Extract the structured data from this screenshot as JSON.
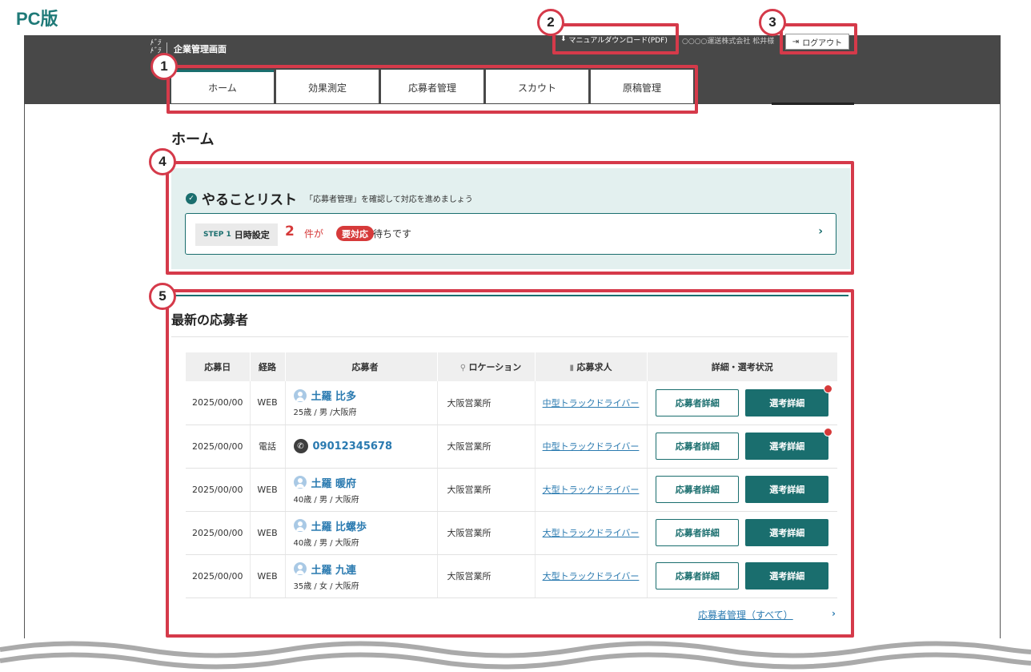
{
  "pc_label": "PC版",
  "header": {
    "logo_text": "ドラ\nドラ",
    "app_title": "企業管理画面",
    "manual_download": "マニュアルダウンロード(PDF)",
    "company": "○○○○運送株式会社 松井様",
    "logout": "ログアウト"
  },
  "tabs": [
    {
      "label": "ホーム",
      "active": true
    },
    {
      "label": "効果測定"
    },
    {
      "label": "応募者管理"
    },
    {
      "label": "スカウト"
    },
    {
      "label": "原稿管理"
    }
  ],
  "page_title": "ホーム",
  "todo": {
    "title": "やることリスト",
    "subtitle": "「応募者管理」を確認して対応を進めましょう",
    "step_label": "STEP 1",
    "step_name": "日時設定",
    "count": "2",
    "text_before": "件が",
    "pill": "要対応",
    "text_after": "待ちです"
  },
  "applicants": {
    "title": "最新の応募者",
    "columns": {
      "date": "応募日",
      "route": "経路",
      "applicant": "応募者",
      "location": "ロケーション",
      "job": "応募求人",
      "actions": "詳細・選考状況"
    },
    "detail_label": "応募者詳細",
    "select_label": "選考詳細",
    "rows": [
      {
        "date": "2025/00/00",
        "route": "WEB",
        "name": "土羅 比多",
        "meta": "25歳 / 男 /大阪府",
        "location": "大阪営業所",
        "job": "中型トラックドライバー",
        "notify": true
      },
      {
        "date": "2025/00/00",
        "route": "電話",
        "name": "09012345678",
        "meta": "",
        "location": "大阪営業所",
        "job": "中型トラックドライバー",
        "notify": true
      },
      {
        "date": "2025/00/00",
        "route": "WEB",
        "name": "土羅 暖府",
        "meta": "40歳 / 男 / 大阪府",
        "location": "大阪営業所",
        "job": "大型トラックドライバー",
        "notify": false
      },
      {
        "date": "2025/00/00",
        "route": "WEB",
        "name": "土羅 比螺歩",
        "meta": "40歳 / 男 / 大阪府",
        "location": "大阪営業所",
        "job": "大型トラックドライバー",
        "notify": false
      },
      {
        "date": "2025/00/00",
        "route": "WEB",
        "name": "土羅 九連",
        "meta": "35歳 / 女 / 大阪府",
        "location": "大阪営業所",
        "job": "大型トラックドライバー",
        "notify": false
      }
    ],
    "all_link": "応募者管理（すべて）"
  },
  "callouts": [
    "1",
    "2",
    "3",
    "4",
    "5"
  ],
  "colors": {
    "accent": "#1a6e6e",
    "highlight": "#d53a4a",
    "alert": "#d63a3a",
    "link": "#2a7ab0"
  }
}
